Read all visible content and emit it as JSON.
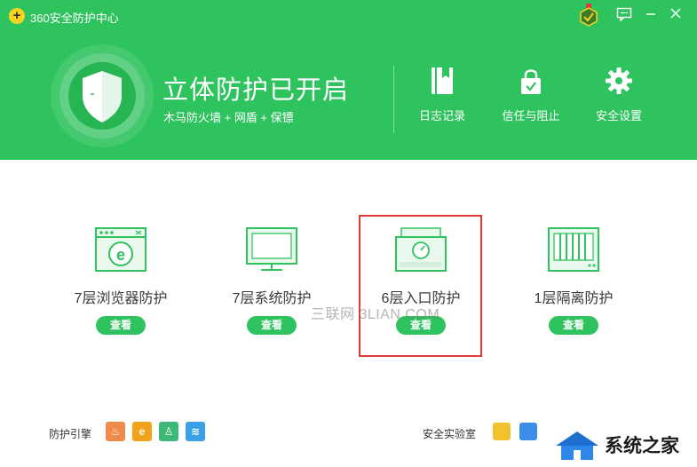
{
  "window": {
    "title": "360安全防护中心",
    "accent": "#2fc35f"
  },
  "status": {
    "title": "立体防护已开启",
    "subtitle": "木马防火墙 + 网盾 + 保镖"
  },
  "tools": [
    {
      "label": "日志记录",
      "icon": "log-book-icon"
    },
    {
      "label": "信任与阻止",
      "icon": "lock-icon"
    },
    {
      "label": "安全设置",
      "icon": "gear-icon"
    }
  ],
  "cards": [
    {
      "label": "7层浏览器防护",
      "button": "查看",
      "icon": "browser-icon"
    },
    {
      "label": "7层系统防护",
      "button": "查看",
      "icon": "monitor-icon"
    },
    {
      "label": "6层入口防护",
      "button": "查看",
      "icon": "entry-drive-icon"
    },
    {
      "label": "1层隔离防护",
      "button": "查看",
      "icon": "isolation-icon"
    }
  ],
  "footer": {
    "engine_label": "防护引擎",
    "engines": [
      {
        "glyph": "♨",
        "color": "#f08a4b"
      },
      {
        "glyph": "e",
        "color": "#f2a31b"
      },
      {
        "glyph": "♙",
        "color": "#3cb878"
      },
      {
        "glyph": "≋",
        "color": "#3aa0e8"
      }
    ],
    "lab_label": "安全实验室"
  },
  "watermark": "三联网 3LIAN.COM",
  "site_logo": "系统之家"
}
